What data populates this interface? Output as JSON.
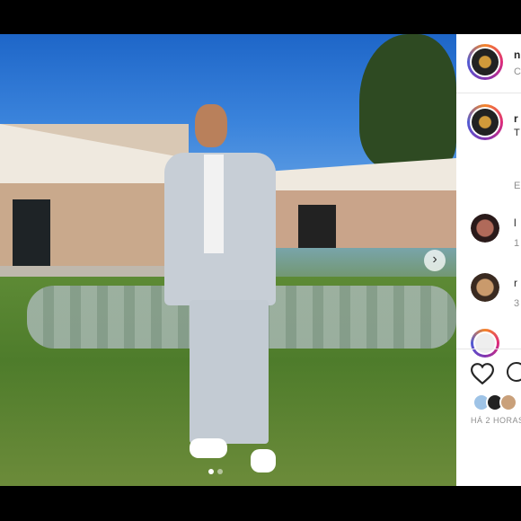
{
  "post": {
    "image_alt": "Man in light grey suit and white sneakers posing in a garden courtyard",
    "carousel": {
      "current": 1,
      "total": 2
    }
  },
  "panel": {
    "header": {
      "username": "n",
      "subtitle": "C"
    },
    "caption": {
      "username": "r",
      "text": "T",
      "meta": "E",
      "link": ""
    },
    "comments": [
      {
        "username": "l",
        "meta": "1"
      },
      {
        "username": "r",
        "meta": "3"
      }
    ],
    "time_label": "HÁ 2 HORAS"
  },
  "colors": {
    "accent": "#0095f6",
    "ring": "#dd2a7b"
  }
}
